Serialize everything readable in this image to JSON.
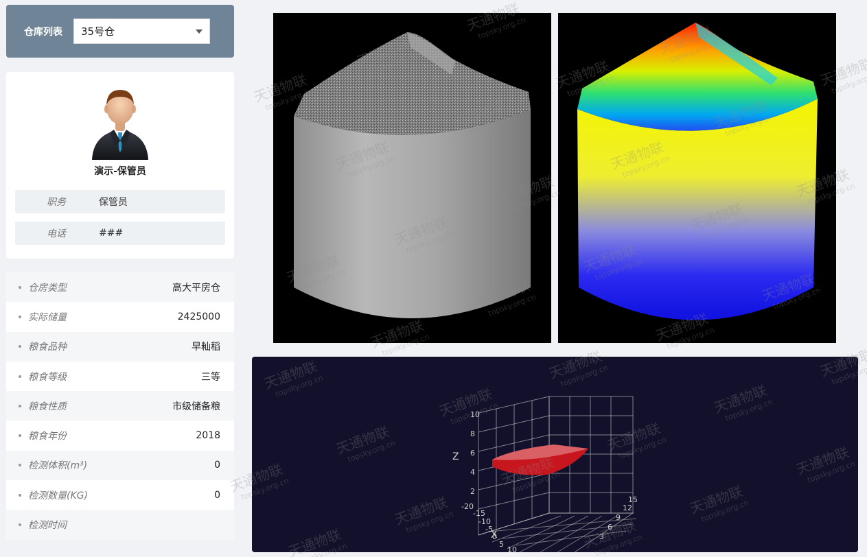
{
  "selector": {
    "label": "仓库列表",
    "selected": "35号仓"
  },
  "profile": {
    "name": "演示-保管员",
    "rows": [
      {
        "key": "职务",
        "value": "保管员"
      },
      {
        "key": "电话",
        "value": "###"
      }
    ]
  },
  "details": [
    {
      "key": "仓房类型",
      "value": "高大平房仓"
    },
    {
      "key": "实际储量",
      "value": "2425000"
    },
    {
      "key": "粮食品种",
      "value": "早籼稻"
    },
    {
      "key": "粮食等级",
      "value": "三等"
    },
    {
      "key": "粮食性质",
      "value": "市级储备粮"
    },
    {
      "key": "粮食年份",
      "value": "2018"
    },
    {
      "key": "检测体积(m³)",
      "value": "0"
    },
    {
      "key": "检测数量(KG)",
      "value": "0"
    },
    {
      "key": "检测时间",
      "value": ""
    }
  ],
  "chart3d": {
    "z_label": "Z",
    "x_label": "X",
    "z_ticks": [
      "10",
      "8",
      "6",
      "4",
      "2",
      "-20"
    ],
    "x_ticks": [
      "-15",
      "-10",
      "-5",
      "0",
      "5",
      "10"
    ],
    "y_ticks": [
      "15",
      "12",
      "9",
      "6",
      "3"
    ]
  },
  "watermark": {
    "title": "天通物联",
    "domain": "topsky.org.cn"
  },
  "colors": {
    "selector_bg": "#6f8496",
    "chart_bg": "#12102a",
    "surface": "#c8161f"
  }
}
